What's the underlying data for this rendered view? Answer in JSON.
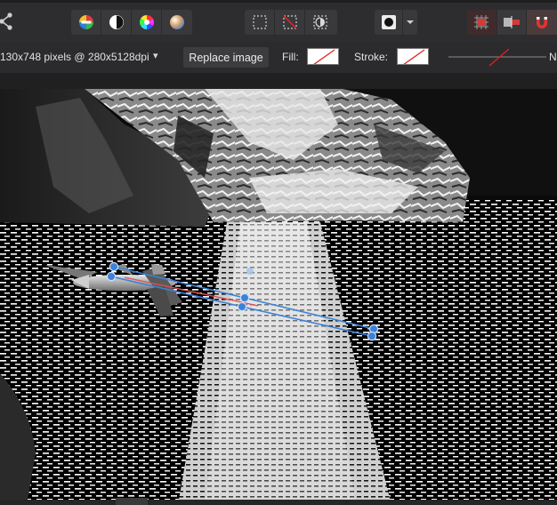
{
  "context_bar": {
    "dimensions_text": "130x748 pixels @ 280x5128dpi",
    "dropdown_arrow": "▾",
    "replace_image_label": "Replace image",
    "fill_label": "Fill:",
    "stroke_label": "Stroke:",
    "truncated_label": "N"
  },
  "icons": {
    "share": "share-icon",
    "color_wheel": "color-wheel-icon",
    "contrast": "contrast-icon",
    "hue_wheel": "hue-wheel-icon",
    "gradient": "gradient-icon",
    "marquee": "marquee-selection-icon",
    "deselect": "deselect-icon",
    "invert_selection": "invert-selection-icon",
    "mask": "mask-icon",
    "grid_snap": "grid-snap-icon",
    "align": "align-icon",
    "magnet": "magnet-icon"
  },
  "colors": {
    "toolbar_bg": "#2d2d2f",
    "accent_blue": "#3b82d8",
    "none_red": "#e02020",
    "magnet_red": "#e3342f"
  }
}
